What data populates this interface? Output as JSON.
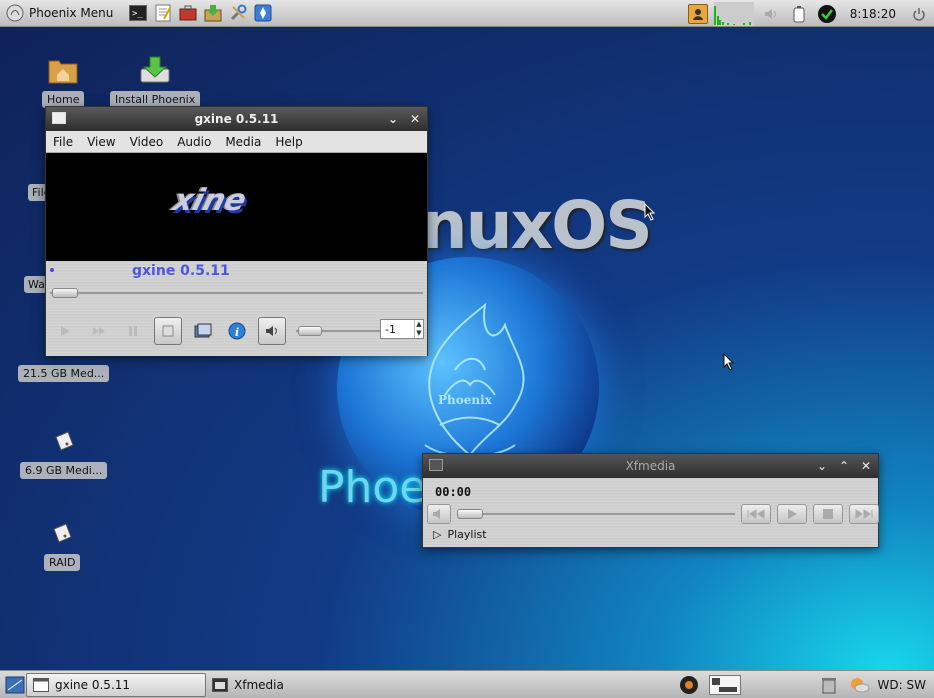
{
  "top_panel": {
    "menu_label": "Phoenix Menu",
    "clock": "8:18:20",
    "launchers": [
      "terminal-icon",
      "text-editor-icon",
      "toolbox-icon",
      "package-installer-icon",
      "settings-icon",
      "file-manager-icon"
    ]
  },
  "desktop": {
    "icons": [
      {
        "label": "Home"
      },
      {
        "label": "Install Phoenix"
      },
      {
        "label": "21.5 GB Med..."
      },
      {
        "label": "6.9 GB Medi..."
      },
      {
        "label": "RAID"
      }
    ],
    "partial_labels": [
      "File",
      "Wa"
    ],
    "wallpaper": {
      "brand_text": "inuxOS",
      "phoenix_text": "Phoe",
      "emblem_text": "Phoenix"
    }
  },
  "gxine": {
    "title": "gxine 0.5.11",
    "menu": [
      "File",
      "View",
      "Video",
      "Audio",
      "Media",
      "Help"
    ],
    "video_logo": "xine",
    "now_playing": "gxine 0.5.11",
    "spin_value": "-1",
    "seek_position": 0,
    "volume_position": 0
  },
  "xfmedia": {
    "title": "Xfmedia",
    "time": "00:00",
    "playlist_label": "Playlist",
    "seek_position": 0
  },
  "taskbar": {
    "tasks": [
      {
        "label": "gxine 0.5.11",
        "active": true
      },
      {
        "label": "Xfmedia",
        "active": false
      }
    ],
    "workspace": "WD: SW"
  },
  "colors": {
    "accent_title": "#4b55e6",
    "desktop_bg": "#123b86"
  }
}
